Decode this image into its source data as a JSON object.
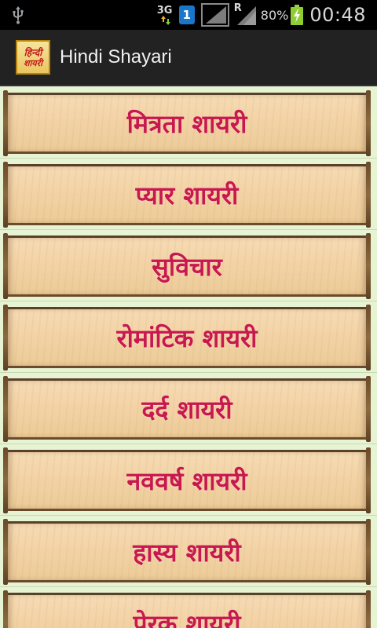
{
  "status_bar": {
    "network_type": "3G",
    "sim_slot": "1",
    "roaming_indicator": "R",
    "battery_percent": "80%",
    "clock": "00:48",
    "icons": [
      "usb-icon",
      "data-arrows-icon",
      "sim-icon",
      "signal-icon",
      "signal-roaming-icon",
      "battery-charging-icon"
    ]
  },
  "action_bar": {
    "app_icon_line1": "हिन्दी",
    "app_icon_line2": "शायरी",
    "title": "Hindi Shayari"
  },
  "menu": {
    "items": [
      {
        "label": "मित्रता शायरी"
      },
      {
        "label": "प्यार शायरी"
      },
      {
        "label": "सुविचार"
      },
      {
        "label": "रोमांटिक शायरी"
      },
      {
        "label": "दर्द शायरी"
      },
      {
        "label": "नववर्ष शायरी"
      },
      {
        "label": "हास्य शायरी"
      },
      {
        "label": "प्रेरक शायरी"
      }
    ]
  },
  "colors": {
    "label": "#c8184f",
    "list_background": "#e7f4d4",
    "action_bar": "#222222",
    "status_bar": "#000000"
  }
}
